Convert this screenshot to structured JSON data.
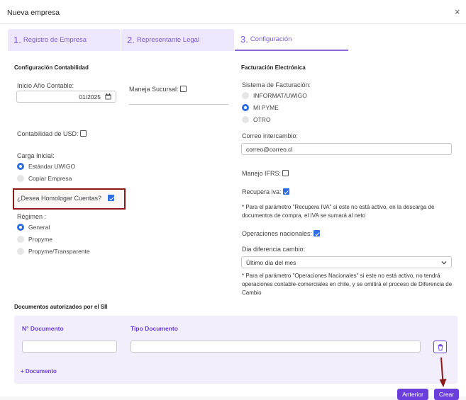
{
  "modal": {
    "title": "Nueva empresa",
    "close": "×"
  },
  "tabs": [
    {
      "num": "1.",
      "label": "Registro de Empresa"
    },
    {
      "num": "2.",
      "label": "Representante Legal"
    },
    {
      "num": "3.",
      "label": "Configuración"
    }
  ],
  "contabilidad": {
    "section_title": "Configuración Contabilidad",
    "inicio_label": "Inicio Año Contable:",
    "inicio_value": "01/2025",
    "sucursal_label": "Maneja Sucursal:",
    "usd_label": "Contabilidad de USD:",
    "carga_label": "Carga Inicial:",
    "carga_options": [
      "Estándar UWIGO",
      "Copiar Empresa"
    ],
    "homologar_label": "¿Desea Homologar Cuentas?",
    "regimen_label": "Régimen :",
    "regimen_options": [
      "General",
      "Propyme",
      "Propyme/Transparente"
    ]
  },
  "facturacion": {
    "section_title": "Facturación Electrónica",
    "sistema_label": "Sistema de Facturación:",
    "sistema_options": [
      "INFORMAT/UWIGO",
      "MI PYME",
      "OTRO"
    ],
    "correo_label": "Correo intercambio:",
    "correo_value": "correo@correo.cl",
    "ifrs_label": "Manejo IFRS:",
    "iva_label": "Recupera iva:",
    "iva_note": "* Para el parámetro \"Recupera IVA\" si este no está activo, en la descarga de documentos de compra, el IVA se sumará al neto",
    "nacionales_label": "Operaciones nacionales:",
    "diferencia_label": "Dia diferencia cambio:",
    "diferencia_value": "Último día del mes",
    "nacionales_note": "* Para el parámetro \"Operaciones Nacionales\" si este no está activo, no tendrá operaciones contable-comerciales en chile, y se omitirá el proceso de Diferencia de Cambio"
  },
  "documentos": {
    "section_title": "Documentos autorizados por el SII",
    "col_numero": "N° Documento",
    "col_tipo": "Tipo Documento",
    "add_label": "+ Documento"
  },
  "footer": {
    "anterior": "Anterior",
    "crear": "Crear"
  },
  "colors": {
    "accent": "#6a3fdc",
    "tab_bg": "#eee7fb",
    "checkbox": "#2f6de0",
    "annotation": "#8b1a1a"
  }
}
